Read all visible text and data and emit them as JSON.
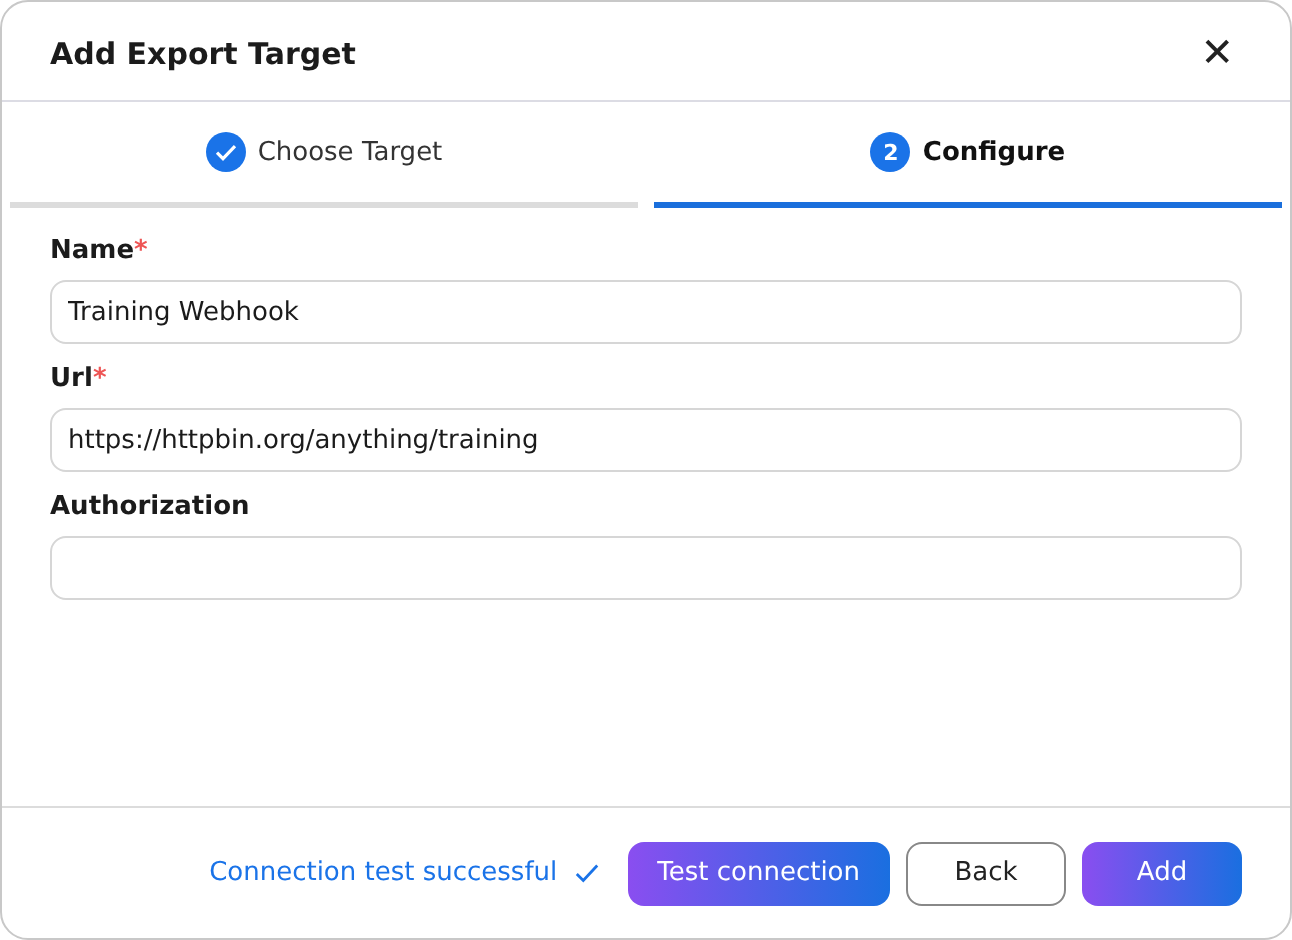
{
  "dialog": {
    "title": "Add Export Target",
    "close_icon": "✕"
  },
  "steps": [
    {
      "label": "Choose Target",
      "done": true,
      "selected": false
    },
    {
      "label": "Configure",
      "number": "2",
      "done": false,
      "selected": true
    }
  ],
  "fields": [
    {
      "label": "Name",
      "required": true,
      "value": "Training Webhook"
    },
    {
      "label": "Url",
      "required": true,
      "value": "https://httpbin.org/anything/training"
    },
    {
      "label": "Authorization",
      "required": false
    }
  ],
  "required_mark": "*",
  "status": {
    "text": "Connection test successful",
    "success": true
  },
  "buttons": [
    {
      "label": "Test connection",
      "kind": "primary"
    },
    {
      "label": "Back",
      "kind": "secondary"
    },
    {
      "label": "Add",
      "kind": "primary"
    }
  ]
}
